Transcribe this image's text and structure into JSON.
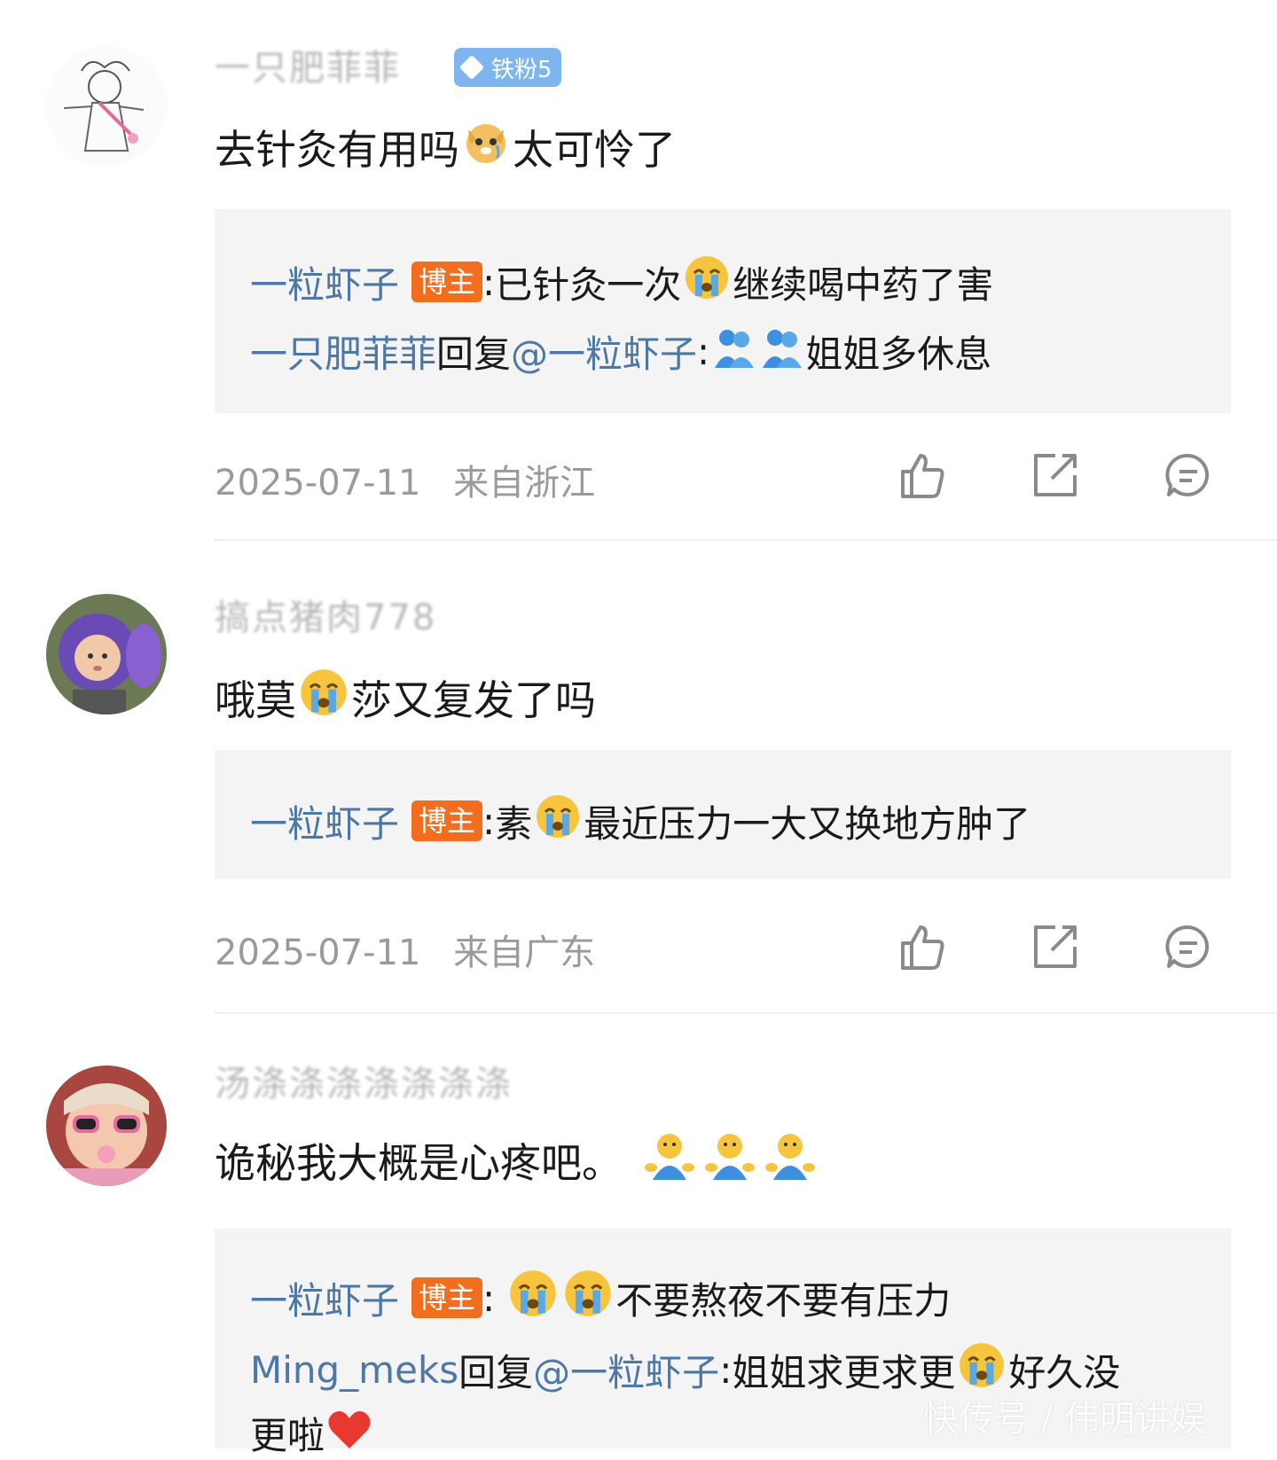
{
  "comments": [
    {
      "username": "一只肥菲菲",
      "fan_badge": "铁粉5",
      "text_before_emoji": "去针灸有用吗",
      "emoji": "crying-dog-emoji",
      "text_after_emoji": "太可怜了",
      "replies": [
        {
          "name": "一粒虾子",
          "badge": "博主",
          "sep": ":",
          "text_a": " 已针灸一次",
          "emoji": "crying-face-emoji",
          "text_b": "继续喝中药了害"
        },
        {
          "name": "一只肥菲菲",
          "reply_word": " 回复",
          "mention": "@一粒虾子",
          "sep": ":",
          "emoji": "hug-emoji",
          "text_b": "姐姐多休息"
        }
      ],
      "date": "2025-07-11",
      "location": "来自浙江"
    },
    {
      "username": "搞点猪肉778",
      "text_before_emoji": "哦莫",
      "emoji": "crying-face-emoji",
      "text_after_emoji": "莎又复发了吗",
      "replies": [
        {
          "name": "一粒虾子",
          "badge": "博主",
          "sep": ":",
          "text_a": " 素",
          "emoji": "crying-face-emoji",
          "text_b": "最近压力一大又换地方肿了"
        }
      ],
      "date": "2025-07-11",
      "location": "来自广东"
    },
    {
      "username": "汤涤涤涤涤涤涤涤",
      "text_before_emoji": "诡秘我大概是心疼吧。",
      "emoji": "hug-emoji",
      "replies": [
        {
          "name": "一粒虾子",
          "badge": "博主",
          "sep": ":",
          "emoji": "crying-face-emoji",
          "text_b": "不要熬夜不要有压力"
        },
        {
          "name": "Ming_meks",
          "reply_word": " 回复",
          "mention": "@一粒虾子",
          "sep": ":",
          "text_a": "姐姐求更求更",
          "emoji": "crying-face-emoji",
          "text_b": "好久没"
        },
        {
          "text_b": "更啦",
          "emoji": "heart-emoji"
        }
      ]
    }
  ],
  "watermark": "快传号 / 伟明讲娱",
  "colors": {
    "link_blue": "#4c77a6",
    "host_badge": "#f26d1d",
    "fan_badge": "#7fb5ef",
    "reply_bg": "#f4f4f4",
    "meta_gray": "#9a9a9a"
  }
}
